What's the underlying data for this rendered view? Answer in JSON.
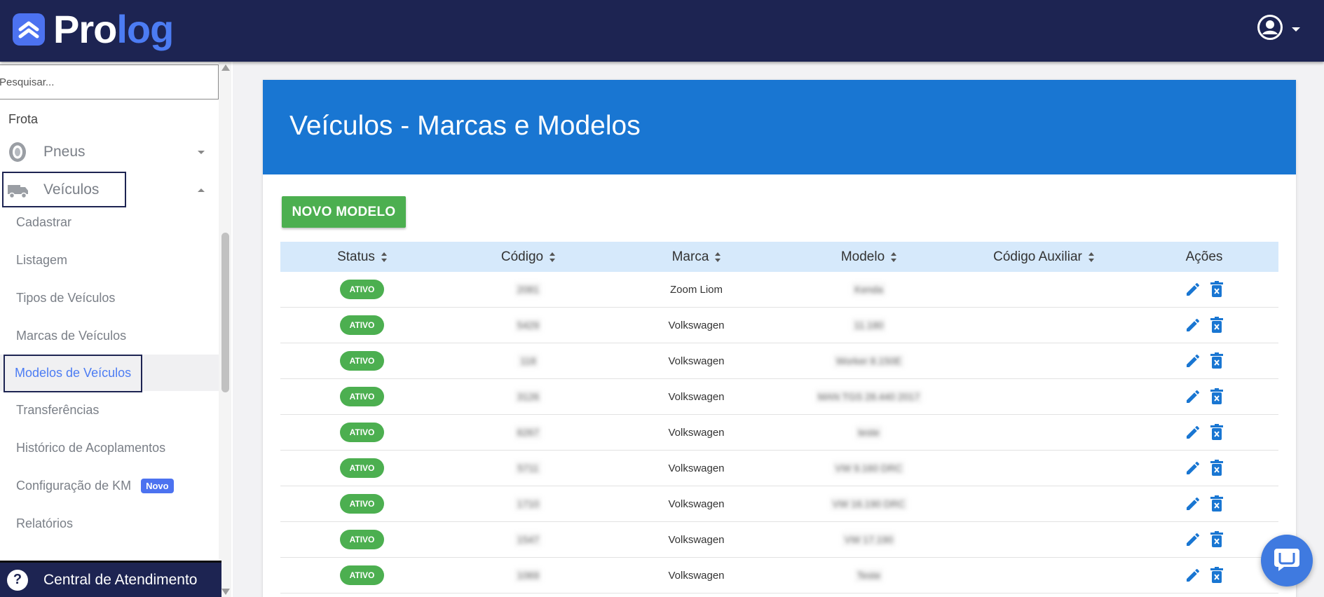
{
  "app": {
    "logo_part1": "Pro",
    "logo_part2": "log"
  },
  "sidebar": {
    "search_placeholder": "Pesquisar...",
    "section": "Frota",
    "groups": [
      {
        "label": "Pneus",
        "icon": "tire-icon",
        "expanded": false
      },
      {
        "label": "Veículos",
        "icon": "truck-icon",
        "expanded": true
      }
    ],
    "items": [
      {
        "label": "Cadastrar"
      },
      {
        "label": "Listagem"
      },
      {
        "label": "Tipos de Veículos"
      },
      {
        "label": "Marcas de Veículos"
      },
      {
        "label": "Modelos de Veículos",
        "active": true
      },
      {
        "label": "Transferências"
      },
      {
        "label": "Histórico de Acoplamentos"
      },
      {
        "label": "Configuração de KM",
        "badge": "Novo"
      },
      {
        "label": "Relatórios"
      }
    ],
    "help_label": "Central de Atendimento"
  },
  "main": {
    "title": "Veículos - Marcas e Modelos",
    "new_button": "NOVO MODELO",
    "columns": [
      "Status",
      "Código",
      "Marca",
      "Modelo",
      "Código Auxiliar",
      "Ações"
    ],
    "rows": [
      {
        "status": "ATIVO",
        "codigo": "2081",
        "marca": "Zoom Liom",
        "modelo": "Kenda",
        "aux": ""
      },
      {
        "status": "ATIVO",
        "codigo": "5429",
        "marca": "Volkswagen",
        "modelo": "11.180",
        "aux": ""
      },
      {
        "status": "ATIVO",
        "codigo": "118",
        "marca": "Volkswagen",
        "modelo": "Worker 8.150E",
        "aux": ""
      },
      {
        "status": "ATIVO",
        "codigo": "3126",
        "marca": "Volkswagen",
        "modelo": "MAN TGS 28.440 2017",
        "aux": ""
      },
      {
        "status": "ATIVO",
        "codigo": "6267",
        "marca": "Volkswagen",
        "modelo": "teste",
        "aux": ""
      },
      {
        "status": "ATIVO",
        "codigo": "5711",
        "marca": "Volkswagen",
        "modelo": "VW 9.160 DRC",
        "aux": ""
      },
      {
        "status": "ATIVO",
        "codigo": "1710",
        "marca": "Volkswagen",
        "modelo": "VW 16.190 DRC",
        "aux": ""
      },
      {
        "status": "ATIVO",
        "codigo": "1547",
        "marca": "Volkswagen",
        "modelo": "VW 17.190",
        "aux": ""
      },
      {
        "status": "ATIVO",
        "codigo": "1069",
        "marca": "Volkswagen",
        "modelo": "Teste",
        "aux": ""
      }
    ]
  },
  "colors": {
    "topbar": "#1d2452",
    "header": "#1976d2",
    "success": "#4caf50",
    "accent": "#4c7cf3",
    "action_icon": "#1976d2"
  }
}
